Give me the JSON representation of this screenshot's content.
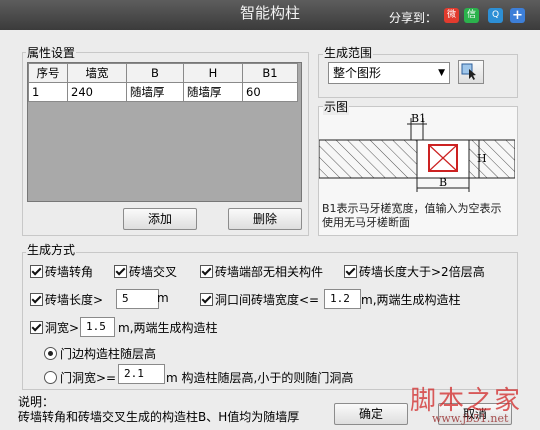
{
  "window": {
    "title": "智能构柱",
    "share_label": "分享到："
  },
  "share_icons": [
    "weibo-icon",
    "wechat-icon",
    "qzone-icon",
    "plus-icon"
  ],
  "props": {
    "label": "属性设置",
    "columns": [
      "序号",
      "墙宽",
      "B",
      "H",
      "B1"
    ],
    "rows": [
      [
        "1",
        "240",
        "随墙厚",
        "随墙厚",
        "60"
      ]
    ],
    "add_label": "添加",
    "delete_label": "删除"
  },
  "range": {
    "label": "生成范围",
    "selected": "整个图形"
  },
  "diagram": {
    "label": "示图",
    "b1": "B1",
    "b": "B",
    "h": "H",
    "caption": "B1表示马牙槎宽度，值输入为空表示使用无马牙槎断面"
  },
  "mode": {
    "label": "生成方式",
    "opt1": "砖墙转角",
    "opt2": "砖墙交叉",
    "opt3": "砖墙端部无相关构件",
    "opt4": "砖墙长度大于>2倍层高",
    "len_label": "砖墙长度>",
    "len_value": "5",
    "len_unit": "m",
    "gap_label": "洞口间砖墙宽度<=",
    "gap_value": "1.2",
    "gap_suffix": "m,两端生成构造柱",
    "hole_label": "洞宽>",
    "hole_value": "1.5",
    "hole_suffix": "m,两端生成构造柱",
    "radio1": "门边构造柱随层高",
    "radio2_label": "门洞宽>=",
    "radio2_value": "2.1",
    "radio2_suffix": "m 构造柱随层高,小于的则随门洞高"
  },
  "note": {
    "title": "说明：",
    "text": "砖墙转角和砖墙交叉生成的构造柱B、H值均为随墙厚"
  },
  "buttons": {
    "ok": "确定",
    "cancel": "取消"
  },
  "watermark": {
    "text": "脚本之家",
    "url": "www.jb51.net"
  },
  "colors": {
    "titlebar": "#4a4a4a",
    "hatch": "#555555",
    "accent_red": "#cc2222"
  }
}
